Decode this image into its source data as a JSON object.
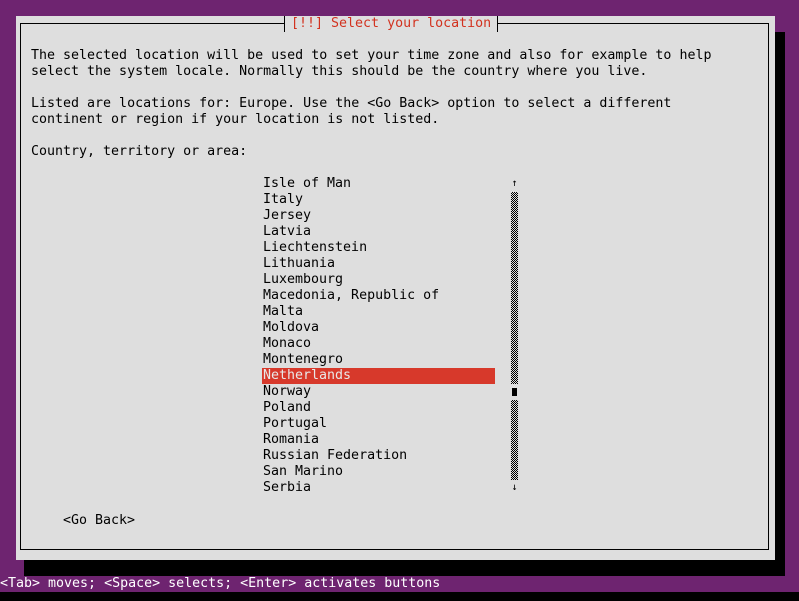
{
  "dialog": {
    "title": "[!!] Select your location",
    "description_line1": "The selected location will be used to set your time zone and also for example to help",
    "description_line2": "select the system locale. Normally this should be the country where you live.",
    "info_line1": "Listed are locations for: Europe. Use the <Go Back> option to select a different",
    "info_line2": "continent or region if your location is not listed.",
    "list_label": "Country, territory or area:",
    "countries": [
      "Isle of Man",
      "Italy",
      "Jersey",
      "Latvia",
      "Liechtenstein",
      "Lithuania",
      "Luxembourg",
      "Macedonia, Republic of",
      "Malta",
      "Moldova",
      "Monaco",
      "Montenegro",
      "Netherlands",
      "Norway",
      "Poland",
      "Portugal",
      "Romania",
      "Russian Federation",
      "San Marino",
      "Serbia"
    ],
    "selected_country": "Netherlands",
    "scroll_up_glyph": "↑",
    "scroll_down_glyph": "↓",
    "go_back_label": "<Go Back>"
  },
  "statusbar": {
    "text": "<Tab> moves; <Space> selects; <Enter> activates buttons"
  },
  "colors": {
    "background": "#6e2470",
    "dialog": "#dedede",
    "title": "#d2321f",
    "selection": "#d7392b"
  }
}
